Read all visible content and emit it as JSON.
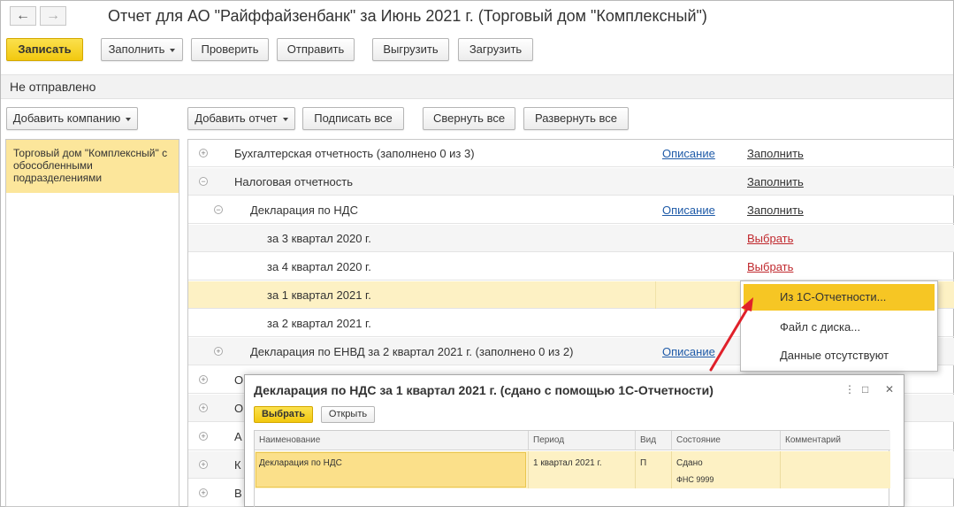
{
  "window": {
    "title": "Отчет для АО \"Райффайзенбанк\" за Июнь 2021 г. (Торговый дом \"Комплексный\")",
    "back_icon": "←",
    "forward_icon": "→"
  },
  "toolbar": {
    "save": "Записать",
    "fill": "Заполнить",
    "check": "Проверить",
    "send": "Отправить",
    "export": "Выгрузить",
    "import": "Загрузить"
  },
  "status": "Не отправлено",
  "toolbar2": {
    "add_company": "Добавить компанию",
    "add_report": "Добавить отчет",
    "sign_all": "Подписать все",
    "collapse_all": "Свернуть все",
    "expand_all": "Развернуть все"
  },
  "companies": [
    {
      "name": "Торговый дом \"Комплексный\" с обособленными подразделениями"
    }
  ],
  "tree": {
    "rows": [
      {
        "label": "Бухгалтерская отчетность (заполнено 0 из 3)",
        "expander": "+",
        "desc": "Описание",
        "action": "Заполнить"
      },
      {
        "label": "Налоговая отчетность",
        "expander": "−",
        "desc": "",
        "action": "Заполнить"
      },
      {
        "label": "Декларация по НДС",
        "expander": "−",
        "desc": "Описание",
        "action": "Заполнить"
      },
      {
        "label": "за 3 квартал 2020 г.",
        "expander": "",
        "desc": "",
        "action": "Выбрать"
      },
      {
        "label": "за 4 квартал 2020 г.",
        "expander": "",
        "desc": "",
        "action": "Выбрать"
      },
      {
        "label": "за 1 квартал 2021 г.",
        "expander": "",
        "desc": "",
        "action": ""
      },
      {
        "label": "за 2 квартал 2021 г.",
        "expander": "",
        "desc": "",
        "action": ""
      },
      {
        "label": "Декларация по ЕНВД за 2 квартал 2021 г. (заполнено 0 из 2)",
        "expander": "+",
        "desc": "Описание",
        "action": ""
      },
      {
        "label": "О",
        "expander": "+",
        "desc": "",
        "action": ""
      },
      {
        "label": "О",
        "expander": "+",
        "desc": "",
        "action": ""
      },
      {
        "label": "А",
        "expander": "+",
        "desc": "",
        "action": ""
      },
      {
        "label": "К",
        "expander": "+",
        "desc": "",
        "action": ""
      },
      {
        "label": "В",
        "expander": "+",
        "desc": "",
        "action": ""
      }
    ]
  },
  "popup_menu": {
    "items": [
      "Из 1С-Отчетности...",
      "Файл с диска...",
      "Данные отсутствуют"
    ]
  },
  "dialog": {
    "title": "Декларация по НДС за 1 квартал 2021 г. (сдано с помощью 1С-Отчетности)",
    "more_icon": "⋮",
    "maximize_icon": "□",
    "close_icon": "✕",
    "select": "Выбрать",
    "open": "Открыть",
    "columns": [
      "Наименование",
      "Период",
      "Вид",
      "Состояние",
      "Комментарий"
    ],
    "rows": [
      {
        "name": "Декларация по НДС",
        "period": "1 квартал 2021 г.",
        "kind": "П",
        "state": "Сдано",
        "state2": "ФНС 9999",
        "comment": ""
      }
    ]
  },
  "colors": {
    "accent_yellow": "#f6c624",
    "selection": "#fdf1c4",
    "link_blue": "#1f5ba8",
    "link_red": "#c0282d",
    "arrow_red": "#e0202a"
  }
}
